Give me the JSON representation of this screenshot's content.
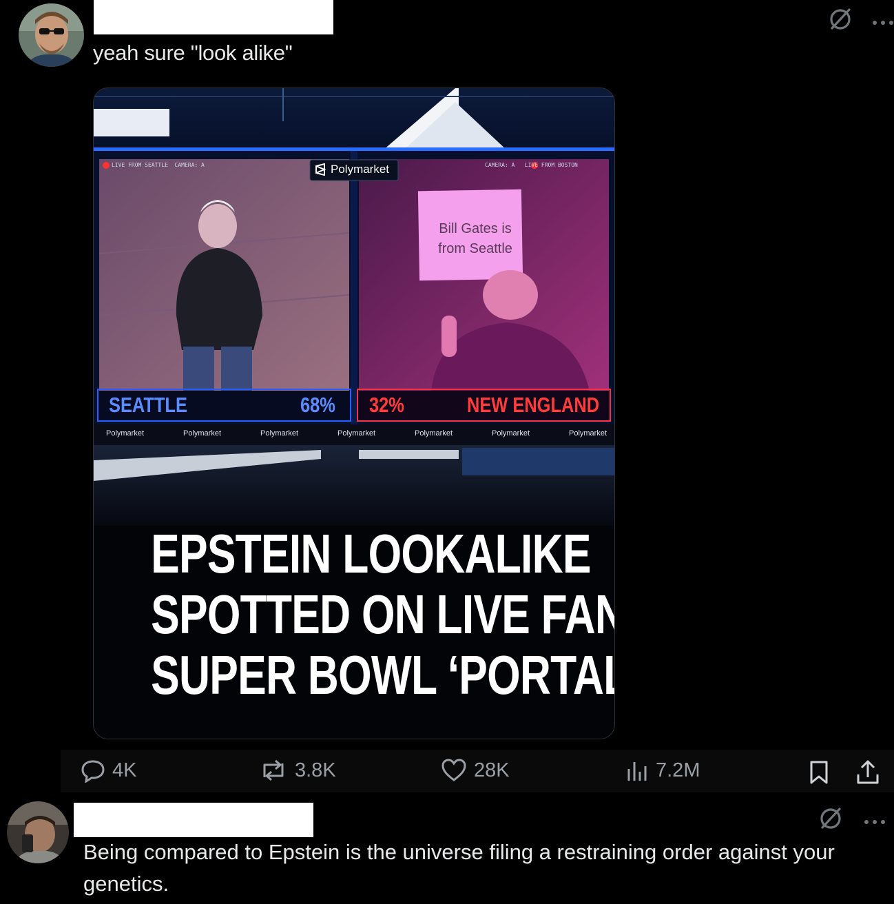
{
  "post": {
    "text": "yeah sure \"look alike\"",
    "icons": [
      "grok-icon",
      "more-icon"
    ],
    "media": {
      "left_feed": {
        "live_label": "LIVE FROM SEATTLE  CAMERA: A",
        "team": "SEATTLE",
        "percent": "68%"
      },
      "right_feed": {
        "live_label": "CAMERA: A   LIVE FROM BOSTON",
        "team": "NEW ENGLAND",
        "percent": "32%",
        "sign_text": "Bill Gates is from Seattle"
      },
      "brand": "Polymarket",
      "ticker": [
        "Polymarket",
        "Polymarket",
        "Polymarket",
        "Polymarket",
        "Polymarket",
        "Polymarket",
        "Polymarket"
      ],
      "headline_lines": [
        "EPSTEIN LOOKALIKE",
        "SPOTTED ON LIVE FAN",
        "SUPER BOWL ‘PORTAL’"
      ]
    },
    "actions": {
      "replies": "4K",
      "reposts": "3.8K",
      "likes": "28K",
      "views": "7.2M"
    }
  },
  "reply": {
    "text": "Being compared to Epstein is the universe filing a restraining order against your genetics."
  },
  "colors": {
    "seattle_blue": "#5a8cff",
    "new_england_red": "#ff3b3b",
    "muted": "#71767b"
  }
}
